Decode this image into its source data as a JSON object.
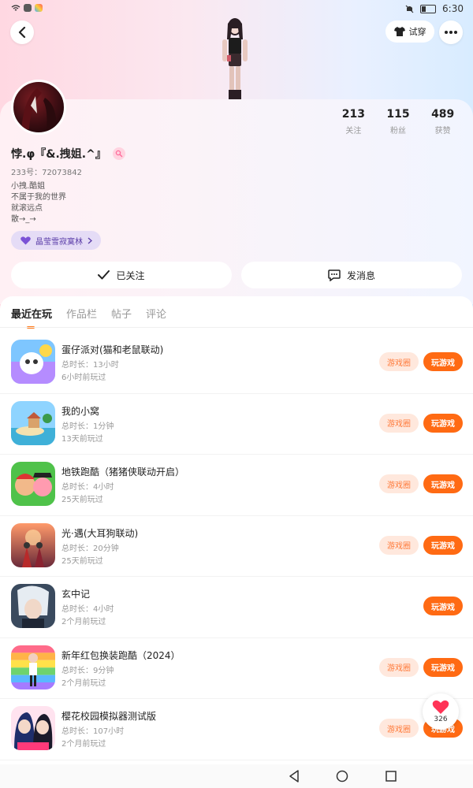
{
  "status_bar": {
    "time": "6:30"
  },
  "header": {
    "try_on_label": "试穿"
  },
  "profile": {
    "stats": [
      {
        "value": "213",
        "label": "关注"
      },
      {
        "value": "115",
        "label": "粉丝"
      },
      {
        "value": "489",
        "label": "获赞"
      }
    ],
    "username": "悖.φ『&.拽姐.^』",
    "uid": "233号：72073842",
    "bio": [
      "小拽.酷姐",
      "不属于我的世界",
      "就滚远点",
      "散→_→"
    ],
    "guild": "晶莹雪寂寞林",
    "follow_label": "已关注",
    "message_label": "发消息"
  },
  "tabs": [
    "最近在玩",
    "作品栏",
    "帖子",
    "评论"
  ],
  "games": [
    {
      "title": "蛋仔派对(猫和老鼠联动)",
      "duration": "总时长：13小时",
      "last": "6小时前玩过",
      "circle": "游戏圈",
      "play": "玩游戏"
    },
    {
      "title": "我的小窝",
      "duration": "总时长：1分钟",
      "last": "13天前玩过",
      "circle": "游戏圈",
      "play": "玩游戏"
    },
    {
      "title": "地铁跑酷（猪猪侠联动开启）",
      "duration": "总时长：4小时",
      "last": "25天前玩过",
      "circle": "游戏圈",
      "play": "玩游戏"
    },
    {
      "title": "光·遇(大耳狗联动)",
      "duration": "总时长：20分钟",
      "last": "25天前玩过",
      "circle": "游戏圈",
      "play": "玩游戏"
    },
    {
      "title": "玄中记",
      "duration": "总时长：4小时",
      "last": "2个月前玩过",
      "circle": "",
      "play": "玩游戏"
    },
    {
      "title": "新年红包换装跑酷（2024）",
      "duration": "总时长：9分钟",
      "last": "2个月前玩过",
      "circle": "游戏圈",
      "play": "玩游戏"
    },
    {
      "title": "樱花校园模拟器测试版",
      "duration": "总时长：107小时",
      "last": "2个月前玩过",
      "circle": "游戏圈",
      "play": "玩游戏"
    }
  ],
  "like_count": "326",
  "colors": {
    "accent": "#ff6a13",
    "circle_bg": "#ffe8dd",
    "guild_bg": "#e5dcf6"
  }
}
